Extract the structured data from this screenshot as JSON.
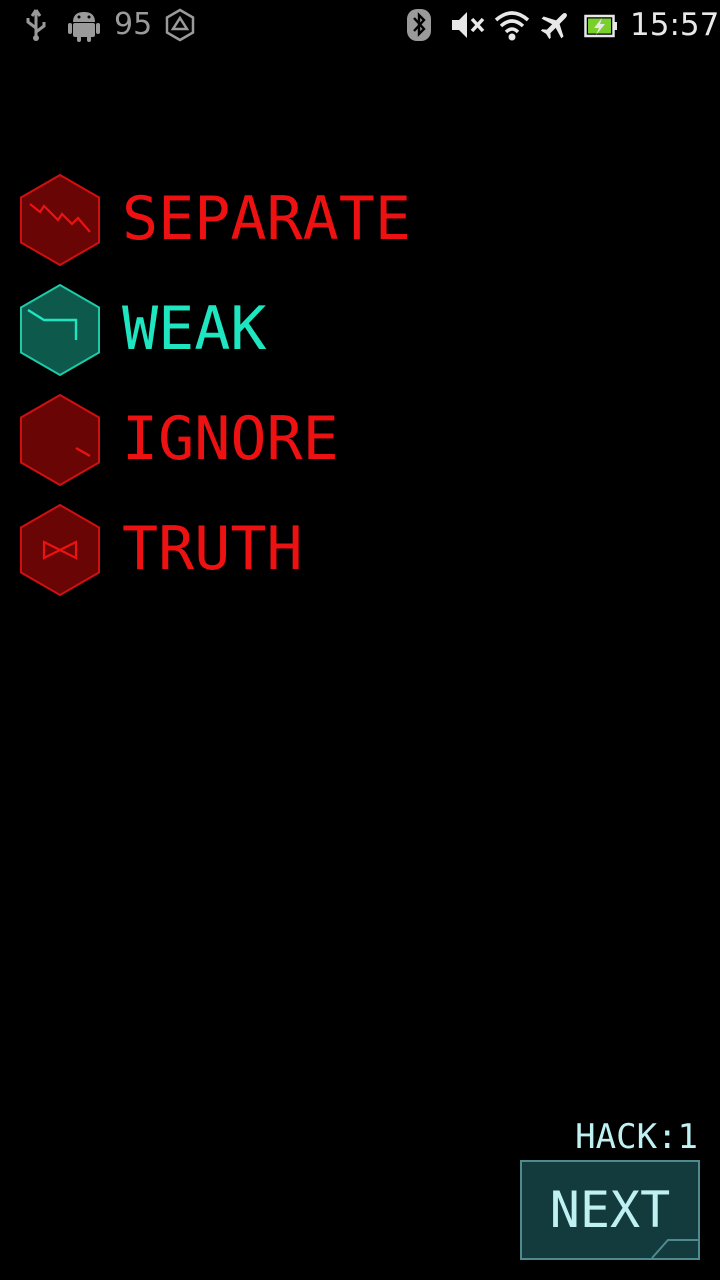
{
  "status_bar": {
    "battery_level_text": "95",
    "time": "15:57",
    "icons": [
      "usb-icon",
      "android-icon",
      "ingress-icon",
      "bluetooth-icon",
      "mute-icon",
      "wifi-icon",
      "airplane-icon",
      "battery-charging-icon"
    ]
  },
  "glyph_sequence": [
    {
      "word": "SEPARATE",
      "state": "incorrect",
      "color": "#ee1111",
      "fill": "#6a0505",
      "stroke": "#d01010",
      "icon": "separate-glyph-icon"
    },
    {
      "word": "WEAK",
      "state": "correct",
      "color": "#1ee6c0",
      "fill": "#0d5a4c",
      "stroke": "#1ec9a8",
      "icon": "weak-glyph-icon"
    },
    {
      "word": "IGNORE",
      "state": "incorrect",
      "color": "#ee1111",
      "fill": "#6a0505",
      "stroke": "#d01010",
      "icon": "ignore-glyph-icon"
    },
    {
      "word": "TRUTH",
      "state": "incorrect",
      "color": "#ee1111",
      "fill": "#6a0505",
      "stroke": "#d01010",
      "icon": "truth-glyph-icon"
    }
  ],
  "hack_counter": "HACK:1",
  "next_button": {
    "label": "NEXT"
  },
  "colors": {
    "background": "#000000",
    "incorrect": "#ee1111",
    "correct": "#1ee6c0",
    "accent": "#bff0f2",
    "button_fill": "#133a3d"
  }
}
